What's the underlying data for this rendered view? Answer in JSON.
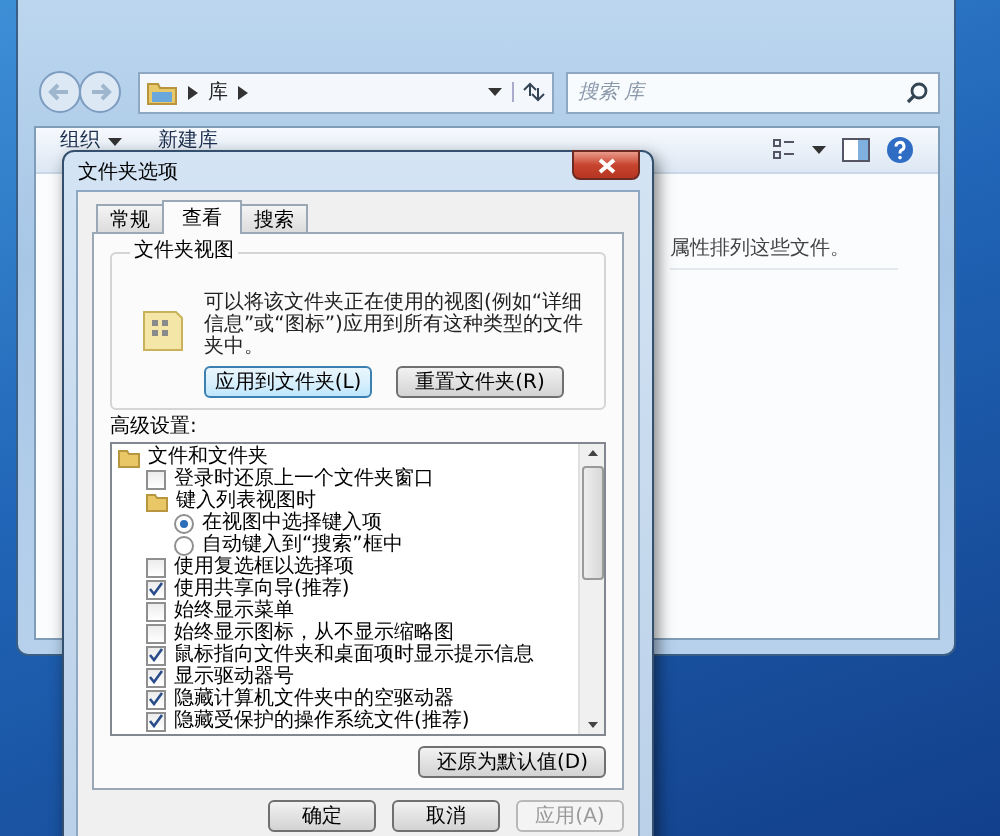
{
  "explorer": {
    "address": "库",
    "search": {
      "placeholder": "搜索 库"
    },
    "toolbar": [
      {
        "label": "组织",
        "dropdown": true
      },
      {
        "label": "新建库",
        "dropdown": false
      }
    ],
    "content_text": "属性排列这些文件。"
  },
  "dialog": {
    "title": "文件夹选项",
    "tabs": [
      {
        "label": "常规",
        "selected": false
      },
      {
        "label": "查看",
        "selected": true
      },
      {
        "label": "搜索",
        "selected": false
      }
    ],
    "folder_views": {
      "title": "文件夹视图",
      "description": "可以将该文件夹正在使用的视图(例如“详细信息”或“图标”)应用到所有这种类型的文件夹中。",
      "buttons": [
        "应用到文件夹(L)",
        "重置文件夹(R)"
      ]
    },
    "advanced_label": "高级设置:",
    "settings": [
      {
        "kind": "folder",
        "label": "文件和文件夹",
        "children": [
          {
            "kind": "checkbox",
            "label": "登录时还原上一个文件夹窗口",
            "checked": false
          },
          {
            "kind": "folder",
            "label": "键入列表视图时",
            "children": [
              {
                "kind": "radio",
                "label": "在视图中选择键入项",
                "selected": true
              },
              {
                "kind": "radio",
                "label": "自动键入到“搜索”框中",
                "selected": false
              }
            ]
          },
          {
            "kind": "checkbox",
            "label": "使用复选框以选择项",
            "checked": false
          },
          {
            "kind": "checkbox",
            "label": "使用共享向导(推荐)",
            "checked": true
          },
          {
            "kind": "checkbox",
            "label": "始终显示菜单",
            "checked": false
          },
          {
            "kind": "checkbox",
            "label": "始终显示图标，从不显示缩略图",
            "checked": false
          },
          {
            "kind": "checkbox",
            "label": "鼠标指向文件夹和桌面项时显示提示信息",
            "checked": true
          },
          {
            "kind": "checkbox",
            "label": "显示驱动器号",
            "checked": true
          },
          {
            "kind": "checkbox",
            "label": "隐藏计算机文件夹中的空驱动器",
            "checked": true
          },
          {
            "kind": "checkbox",
            "label": "隐藏受保护的操作系统文件(推荐)",
            "checked": true
          }
        ]
      }
    ],
    "restore_button": "还原为默认值(D)",
    "buttons": [
      {
        "label": "确定",
        "disabled": false
      },
      {
        "label": "取消",
        "disabled": false
      },
      {
        "label": "应用(A)",
        "disabled": true
      }
    ]
  }
}
